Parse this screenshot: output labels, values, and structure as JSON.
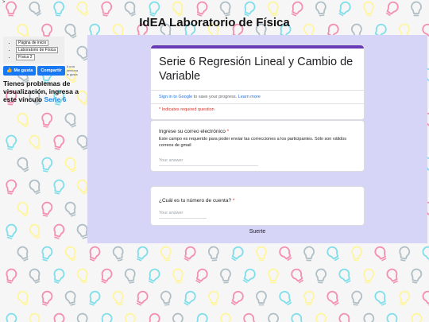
{
  "page": {
    "gt_mark": ">",
    "site_title": "IdEA Laboratorio de Física"
  },
  "sidebar": {
    "breadcrumbs": [
      "Página de inicio",
      "Laboratorio de Física",
      "Física 2"
    ],
    "like_label": "Me gusta",
    "share_label": "Compartir",
    "fb_note": "A una persona le gusta",
    "help_text": "Tienes problemas de visualización, ingresa a este vínculo",
    "help_link": "Serie 6"
  },
  "form": {
    "title": "Serie 6 Regresión Lineal y Cambio de Variable",
    "signin_link": "Sign in to Google",
    "signin_text": "to save your progress.",
    "learn_more": "Learn more",
    "required_note": "* Indicates required question",
    "q1": {
      "label": "Ingrese su correo electrónico",
      "required_mark": "*",
      "help": "Este campo es requerido para poder enviar las correcciones a los participantes. Sólo son válidos correos de gmail",
      "placeholder": "Your answer"
    },
    "q2": {
      "label": "¿Cuál es tu número de cuenta?",
      "required_mark": "*",
      "placeholder": "Your answer"
    },
    "footer_text": "Suerte"
  },
  "colors": {
    "accent": "#673ab7",
    "frame_bg": "#d6d4f7",
    "link": "#1a73e8",
    "required": "#d93025",
    "facebook": "#1877f2",
    "bulb_palette": [
      "#f48fb1",
      "#fff59d",
      "#80deea",
      "#b0bec5"
    ]
  },
  "icons": {
    "background": "lightbulb-icon",
    "like": "thumbs-up-icon"
  }
}
